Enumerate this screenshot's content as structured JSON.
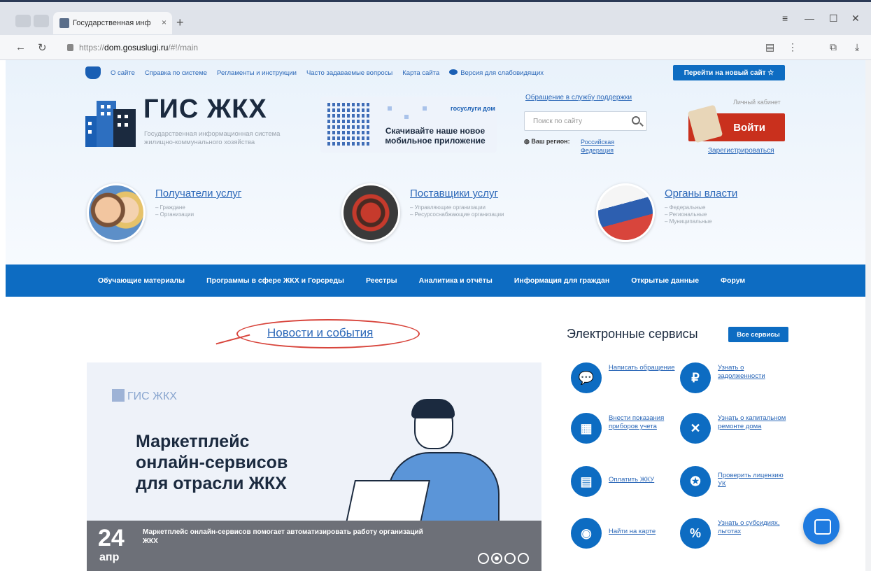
{
  "browser": {
    "tab_title": "Государственная инф",
    "tab_close": "×",
    "new_tab": "+",
    "url_prefix": "https://",
    "url_host": "dom.gosuslugi.ru",
    "url_path": "/#!/main",
    "win_controls": [
      "≡",
      "—",
      "☐",
      "✕"
    ]
  },
  "topnav": {
    "links": [
      "О сайте",
      "Справка по системе",
      "Регламенты и инструкции",
      "Часто задаваемые вопросы",
      "Карта сайта"
    ],
    "accessibility": "Версия для слабовидящих",
    "new_site_button": "Перейти на новый сайт"
  },
  "header": {
    "logo_title": "ГИС ЖКХ",
    "logo_subtitle": "Государственная информационная система жилищно-коммунального хозяйства",
    "promo_brand": "госуслуги дом",
    "promo_text": "Скачивайте наше новое мобильное приложение",
    "support_link": "Обращение в службу поддержки",
    "search_placeholder": "Поиск по сайту",
    "region_label": "Ваш регион:",
    "region_value": "Российская Федерация",
    "cabinet_label": "Личный кабинет",
    "login_button": "Войти",
    "register_link": "Зарегистрироваться"
  },
  "audiences": [
    {
      "title": "Получатели услуг",
      "items": [
        "– Граждане",
        "– Организации"
      ],
      "color": "#e3a072"
    },
    {
      "title": "Поставщики услуг",
      "items": [
        "– Управляющие организации",
        "– Ресурсоснабжающие организации"
      ],
      "color": "#7a4a3a"
    },
    {
      "title": "Органы власти",
      "items": [
        "– Федеральные",
        "– Региональные",
        "– Муниципальные"
      ],
      "color": "#d8453c"
    }
  ],
  "mainnav": [
    "Обучающие материалы",
    "Программы в сфере ЖКХ и Горсреды",
    "Реестры",
    "Аналитика и отчёты",
    "Информация для граждан",
    "Открытые данные",
    "Форум"
  ],
  "news": {
    "heading": "Новости и события",
    "banner_logo": "ГИС ЖКХ",
    "banner_title": "Маркетплейс онлайн-сервисов для отрасли ЖКХ",
    "day": "24",
    "month": "апр",
    "caption": "Маркетплейс онлайн-сервисов помогает автоматизировать работу организаций ЖКХ"
  },
  "services": {
    "title": "Электронные сервисы",
    "all_button": "Все сервисы",
    "items": [
      {
        "label": "Написать обращение",
        "glyph": "💬"
      },
      {
        "label": "Узнать о задолженности",
        "glyph": "₽"
      },
      {
        "label": "Внести показания приборов учета",
        "glyph": "▦"
      },
      {
        "label": "Узнать о капитальном ремонте дома",
        "glyph": "✕"
      },
      {
        "label": "Оплатить ЖКУ",
        "glyph": "▤"
      },
      {
        "label": "Проверить лицензию УК",
        "glyph": "✪"
      },
      {
        "label": "Найти на карте",
        "glyph": "◉"
      },
      {
        "label": "Узнать о субсидиях, льготах",
        "glyph": "%"
      }
    ]
  }
}
